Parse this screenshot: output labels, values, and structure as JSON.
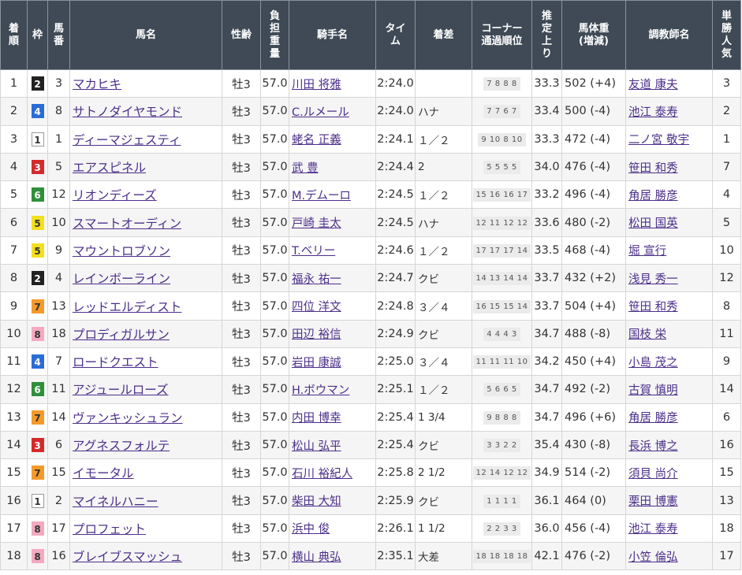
{
  "headers": [
    "着順",
    "枠",
    "馬番",
    "馬名",
    "性齢",
    "負担重量",
    "騎手名",
    "タイム",
    "着差",
    "コーナー通過順位",
    "推定上り",
    "馬体重(増減)",
    "調教師名",
    "単勝人気"
  ],
  "header_lines": {
    "rank": [
      "着",
      "順"
    ],
    "waku": [
      "枠"
    ],
    "num": [
      "馬",
      "番"
    ],
    "horse": [
      "馬名"
    ],
    "sex": [
      "性齢"
    ],
    "weight": [
      "負",
      "担",
      "重",
      "量"
    ],
    "jockey": [
      "騎手名"
    ],
    "time": [
      "タイ",
      "ム"
    ],
    "margin": [
      "着差"
    ],
    "corner": [
      "コーナー",
      "通過順位"
    ],
    "agari": [
      "推",
      "定",
      "上",
      "り"
    ],
    "body": [
      "馬体重",
      "(増減)"
    ],
    "trainer": [
      "調教師名"
    ],
    "pop": [
      "単",
      "勝",
      "人",
      "気"
    ]
  },
  "waku_colors": {
    "1": {
      "bg": "#ffffff",
      "fg": "#333333",
      "border": "#999999"
    },
    "2": {
      "bg": "#222222",
      "fg": "#ffffff",
      "border": "#222222"
    },
    "3": {
      "bg": "#d62a2a",
      "fg": "#ffffff",
      "border": "#d62a2a"
    },
    "4": {
      "bg": "#2a6dd6",
      "fg": "#ffffff",
      "border": "#2a6dd6"
    },
    "5": {
      "bg": "#f2e020",
      "fg": "#333333",
      "border": "#f2e020"
    },
    "6": {
      "bg": "#2f8f3a",
      "fg": "#ffffff",
      "border": "#2f8f3a"
    },
    "7": {
      "bg": "#f59a2a",
      "fg": "#333333",
      "border": "#f59a2a"
    },
    "8": {
      "bg": "#f4a9c0",
      "fg": "#333333",
      "border": "#f4a9c0"
    }
  },
  "rows": [
    {
      "rank": "1",
      "waku": "2",
      "num": "3",
      "horse": "マカヒキ",
      "sex": "牡3",
      "weight": "57.0",
      "jockey": "川田 将雅",
      "time": "2:24.0",
      "margin": "",
      "corner": "7 8 8 8",
      "agari": "33.3",
      "body": "502 (+4)",
      "trainer": "友道 康夫",
      "pop": "3"
    },
    {
      "rank": "2",
      "waku": "4",
      "num": "8",
      "horse": "サトノダイヤモンド",
      "sex": "牡3",
      "weight": "57.0",
      "jockey": "C.ルメール",
      "time": "2:24.0",
      "margin": "ハナ",
      "corner": "7 7 6 7",
      "agari": "33.4",
      "body": "500 (-4)",
      "trainer": "池江 泰寿",
      "pop": "2"
    },
    {
      "rank": "3",
      "waku": "1",
      "num": "1",
      "horse": "ディーマジェスティ",
      "sex": "牡3",
      "weight": "57.0",
      "jockey": "蛯名 正義",
      "time": "2:24.1",
      "margin": "１／２",
      "corner": "9 10 8 10",
      "agari": "33.3",
      "body": "472 (-4)",
      "trainer": "二ノ宮 敬宇",
      "pop": "1"
    },
    {
      "rank": "4",
      "waku": "3",
      "num": "5",
      "horse": "エアスピネル",
      "sex": "牡3",
      "weight": "57.0",
      "jockey": "武 豊",
      "time": "2:24.4",
      "margin": "2",
      "corner": "5 5 5 5",
      "agari": "34.0",
      "body": "476 (-4)",
      "trainer": "笹田 和秀",
      "pop": "7"
    },
    {
      "rank": "5",
      "waku": "6",
      "num": "12",
      "horse": "リオンディーズ",
      "sex": "牡3",
      "weight": "57.0",
      "jockey": "M.デムーロ",
      "time": "2:24.5",
      "margin": "１／２",
      "corner": "15 16 16 17",
      "agari": "33.2",
      "body": "496 (-4)",
      "trainer": "角居 勝彦",
      "pop": "4"
    },
    {
      "rank": "6",
      "waku": "5",
      "num": "10",
      "horse": "スマートオーディン",
      "sex": "牡3",
      "weight": "57.0",
      "jockey": "戸崎 圭太",
      "time": "2:24.5",
      "margin": "ハナ",
      "corner": "12 11 12 12",
      "agari": "33.6",
      "body": "480 (-2)",
      "trainer": "松田 国英",
      "pop": "5"
    },
    {
      "rank": "7",
      "waku": "5",
      "num": "9",
      "horse": "マウントロブソン",
      "sex": "牡3",
      "weight": "57.0",
      "jockey": "T.ベリー",
      "time": "2:24.6",
      "margin": "１／２",
      "corner": "17 17 17 14",
      "agari": "33.5",
      "body": "468 (-4)",
      "trainer": "堀 宣行",
      "pop": "10"
    },
    {
      "rank": "8",
      "waku": "2",
      "num": "4",
      "horse": "レインボーライン",
      "sex": "牡3",
      "weight": "57.0",
      "jockey": "福永 祐一",
      "time": "2:24.7",
      "margin": "クビ",
      "corner": "14 13 14 14",
      "agari": "33.7",
      "body": "432 (+2)",
      "trainer": "浅見 秀一",
      "pop": "12"
    },
    {
      "rank": "9",
      "waku": "7",
      "num": "13",
      "horse": "レッドエルディスト",
      "sex": "牡3",
      "weight": "57.0",
      "jockey": "四位 洋文",
      "time": "2:24.8",
      "margin": "３／４",
      "corner": "16 15 15 14",
      "agari": "33.7",
      "body": "504 (+4)",
      "trainer": "笹田 和秀",
      "pop": "8"
    },
    {
      "rank": "10",
      "waku": "8",
      "num": "18",
      "horse": "プロディガルサン",
      "sex": "牡3",
      "weight": "57.0",
      "jockey": "田辺 裕信",
      "time": "2:24.9",
      "margin": "クビ",
      "corner": "4 4 4 3",
      "agari": "34.7",
      "body": "488 (-8)",
      "trainer": "国枝 栄",
      "pop": "11"
    },
    {
      "rank": "11",
      "waku": "4",
      "num": "7",
      "horse": "ロードクエスト",
      "sex": "牡3",
      "weight": "57.0",
      "jockey": "岩田 康誠",
      "time": "2:25.0",
      "margin": "３／４",
      "corner": "11 11 11 10",
      "agari": "34.2",
      "body": "450 (+4)",
      "trainer": "小島 茂之",
      "pop": "9"
    },
    {
      "rank": "12",
      "waku": "6",
      "num": "11",
      "horse": "アジュールローズ",
      "sex": "牡3",
      "weight": "57.0",
      "jockey": "H.ボウマン",
      "time": "2:25.1",
      "margin": "１／２",
      "corner": "5 6 6 5",
      "agari": "34.7",
      "body": "492 (-2)",
      "trainer": "古賀 慎明",
      "pop": "14"
    },
    {
      "rank": "13",
      "waku": "7",
      "num": "14",
      "horse": "ヴァンキッシュラン",
      "sex": "牡3",
      "weight": "57.0",
      "jockey": "内田 博幸",
      "time": "2:25.4",
      "margin": "1 3/4",
      "corner": "9 8 8 8",
      "agari": "34.7",
      "body": "496 (+6)",
      "trainer": "角居 勝彦",
      "pop": "6"
    },
    {
      "rank": "14",
      "waku": "3",
      "num": "6",
      "horse": "アグネスフォルテ",
      "sex": "牡3",
      "weight": "57.0",
      "jockey": "松山 弘平",
      "time": "2:25.4",
      "margin": "クビ",
      "corner": "3 3 2 2",
      "agari": "35.4",
      "body": "430 (-8)",
      "trainer": "長浜 博之",
      "pop": "16"
    },
    {
      "rank": "15",
      "waku": "7",
      "num": "15",
      "horse": "イモータル",
      "sex": "牡3",
      "weight": "57.0",
      "jockey": "石川 裕紀人",
      "time": "2:25.8",
      "margin": "2 1/2",
      "corner": "12 14 12 12",
      "agari": "34.9",
      "body": "514 (-2)",
      "trainer": "須貝 尚介",
      "pop": "15"
    },
    {
      "rank": "16",
      "waku": "1",
      "num": "2",
      "horse": "マイネルハニー",
      "sex": "牡3",
      "weight": "57.0",
      "jockey": "柴田 大知",
      "time": "2:25.9",
      "margin": "クビ",
      "corner": "1 1 1 1",
      "agari": "36.1",
      "body": "464 (0)",
      "trainer": "栗田 博憲",
      "pop": "13"
    },
    {
      "rank": "17",
      "waku": "8",
      "num": "17",
      "horse": "プロフェット",
      "sex": "牡3",
      "weight": "57.0",
      "jockey": "浜中 俊",
      "time": "2:26.1",
      "margin": "1 1/2",
      "corner": "2 2 3 3",
      "agari": "36.0",
      "body": "456 (-4)",
      "trainer": "池江 泰寿",
      "pop": "18"
    },
    {
      "rank": "18",
      "waku": "8",
      "num": "16",
      "horse": "ブレイブスマッシュ",
      "sex": "牡3",
      "weight": "57.0",
      "jockey": "横山 典弘",
      "time": "2:35.1",
      "margin": "大差",
      "corner": "18 18 18 18",
      "agari": "42.1",
      "body": "476 (-2)",
      "trainer": "小笠 倫弘",
      "pop": "17"
    }
  ]
}
